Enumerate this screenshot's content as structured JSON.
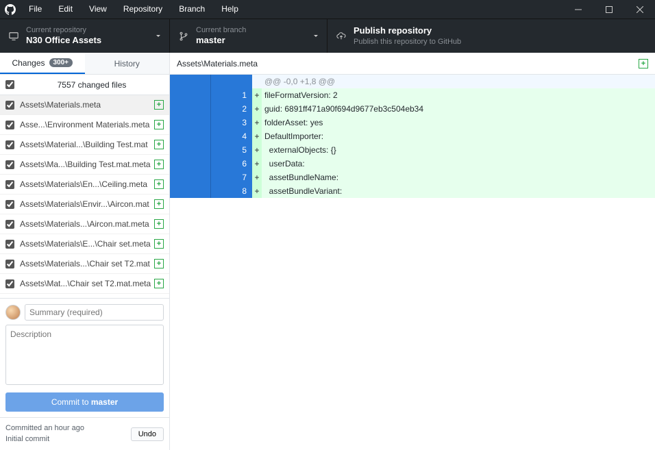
{
  "menu": {
    "file": "File",
    "edit": "Edit",
    "view": "View",
    "repository": "Repository",
    "branch": "Branch",
    "help": "Help"
  },
  "header": {
    "repo": {
      "label": "Current repository",
      "name": "N30 Office Assets"
    },
    "branch": {
      "label": "Current branch",
      "name": "master"
    },
    "publish": {
      "title": "Publish repository",
      "sub": "Publish this repository to GitHub"
    }
  },
  "tabs": {
    "changes": {
      "label": "Changes",
      "badge": "300+"
    },
    "history": {
      "label": "History"
    }
  },
  "filesHeader": {
    "label": "7557 changed files"
  },
  "files": [
    {
      "name": "Assets\\Materials.meta",
      "selected": true
    },
    {
      "name": "Asse...\\Environment Materials.meta"
    },
    {
      "name": "Assets\\Material...\\Building Test.mat"
    },
    {
      "name": "Assets\\Ma...\\Building Test.mat.meta"
    },
    {
      "name": "Assets\\Materials\\En...\\Ceiling.meta"
    },
    {
      "name": "Assets\\Materials\\Envir...\\Aircon.mat"
    },
    {
      "name": "Assets\\Materials...\\Aircon.mat.meta"
    },
    {
      "name": "Assets\\Materials\\E...\\Chair set.meta"
    },
    {
      "name": "Assets\\Materials...\\Chair set T2.mat"
    },
    {
      "name": "Assets\\Mat...\\Chair set T2.mat.meta"
    }
  ],
  "commit": {
    "summaryPlaceholder": "Summary (required)",
    "descPlaceholder": "Description",
    "buttonPrefix": "Commit to ",
    "buttonBranch": "master"
  },
  "undo": {
    "line1": "Committed an hour ago",
    "line2": "Initial commit",
    "button": "Undo"
  },
  "diff": {
    "path": "Assets\\Materials.meta",
    "hunk": "@@ -0,0 +1,8 @@",
    "lines": [
      {
        "n": "1",
        "t": "+fileFormatVersion: 2"
      },
      {
        "n": "2",
        "t": "+guid: 6891ff471a90f694d9677eb3c504eb34"
      },
      {
        "n": "3",
        "t": "+folderAsset: yes"
      },
      {
        "n": "4",
        "t": "+DefaultImporter:"
      },
      {
        "n": "5",
        "t": "+  externalObjects: {}"
      },
      {
        "n": "6",
        "t": "+  userData:"
      },
      {
        "n": "7",
        "t": "+  assetBundleName:"
      },
      {
        "n": "8",
        "t": "+  assetBundleVariant:"
      }
    ]
  }
}
